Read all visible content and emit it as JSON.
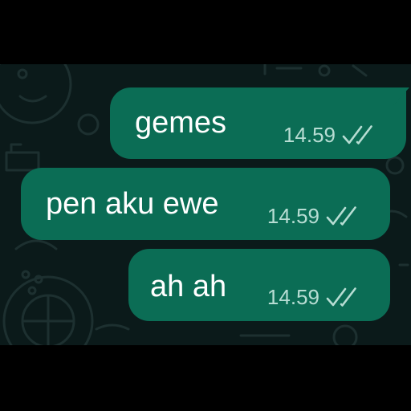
{
  "chat": {
    "messages": [
      {
        "text": "gemes",
        "time": "14.59",
        "status_icon": "double-check-icon"
      },
      {
        "text": "pen aku ewe",
        "time": "14.59",
        "status_icon": "double-check-icon"
      },
      {
        "text": "ah ah",
        "time": "14.59",
        "status_icon": "double-check-icon"
      }
    ]
  },
  "colors": {
    "background": "#0b1a1a",
    "outgoing_bubble": "#0b6d55",
    "message_text": "#ffffff",
    "meta_text": "#b7ddd3",
    "read_ticks": "#b7ddd3"
  }
}
